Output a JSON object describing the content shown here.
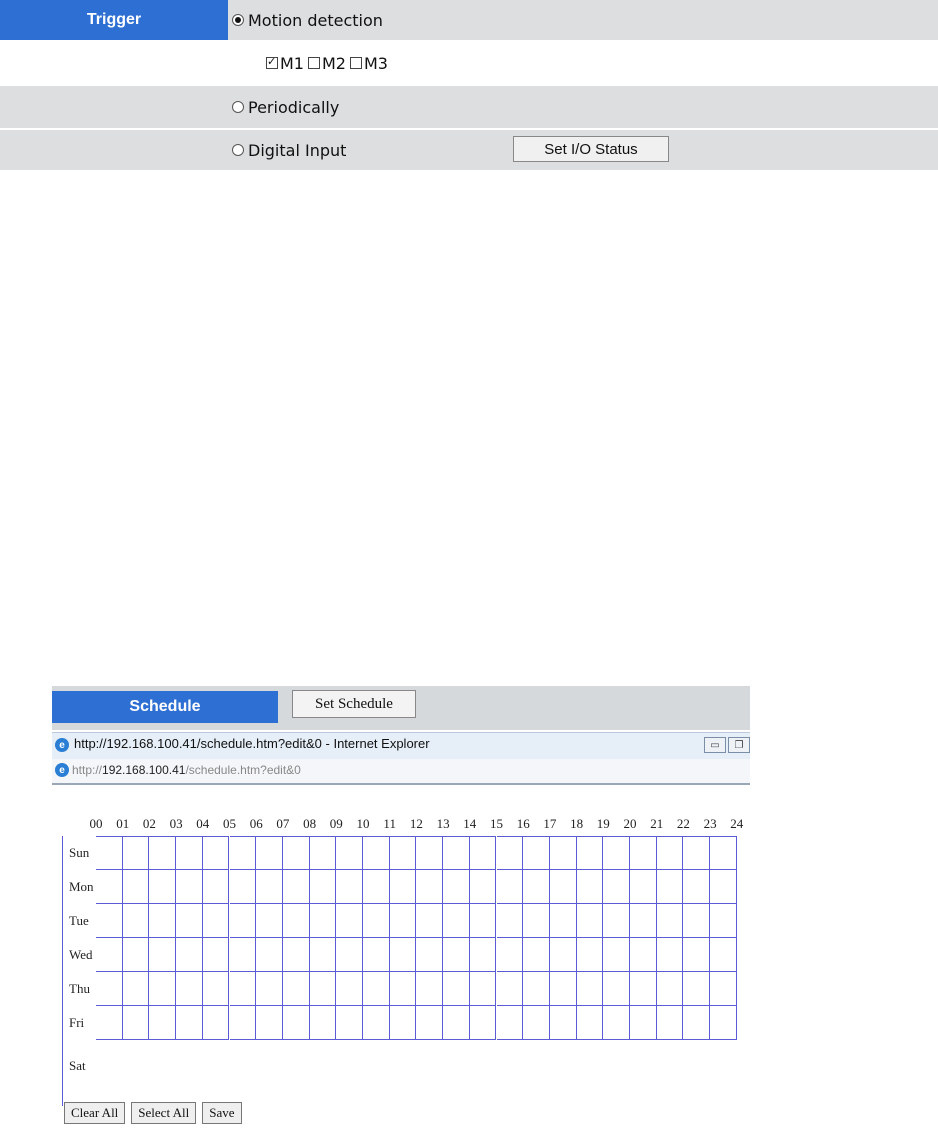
{
  "trigger": {
    "label": "Trigger",
    "options": {
      "motion": {
        "label": "Motion detection",
        "selected": true
      },
      "periodic": {
        "label": "Periodically",
        "selected": false
      },
      "digital": {
        "label": "Digital Input",
        "selected": false
      }
    },
    "zones": [
      {
        "label": "M1",
        "checked": true
      },
      {
        "label": "M2",
        "checked": false
      },
      {
        "label": "M3",
        "checked": false
      }
    ],
    "io_button": "Set I/O Status"
  },
  "schedule": {
    "label": "Schedule",
    "set_button": "Set Schedule",
    "window_title": "http://192.168.100.41/schedule.htm?edit&0 - Internet Explorer",
    "address": {
      "prefix": "http://",
      "host": "192.168.100.41",
      "path": "/schedule.htm?edit&0"
    },
    "hours": [
      "00",
      "01",
      "02",
      "03",
      "04",
      "05",
      "06",
      "07",
      "08",
      "09",
      "10",
      "11",
      "12",
      "13",
      "14",
      "15",
      "16",
      "17",
      "18",
      "19",
      "20",
      "21",
      "22",
      "23",
      "24"
    ],
    "days": [
      "Sun",
      "Mon",
      "Tue",
      "Wed",
      "Thu",
      "Fri",
      "Sat"
    ],
    "buttons": {
      "clear": "Clear All",
      "select": "Select All",
      "save": "Save"
    }
  },
  "colors": {
    "accent": "#2e6fd3",
    "grid": "#5b5bd6",
    "row_gray": "#dcdedf"
  }
}
